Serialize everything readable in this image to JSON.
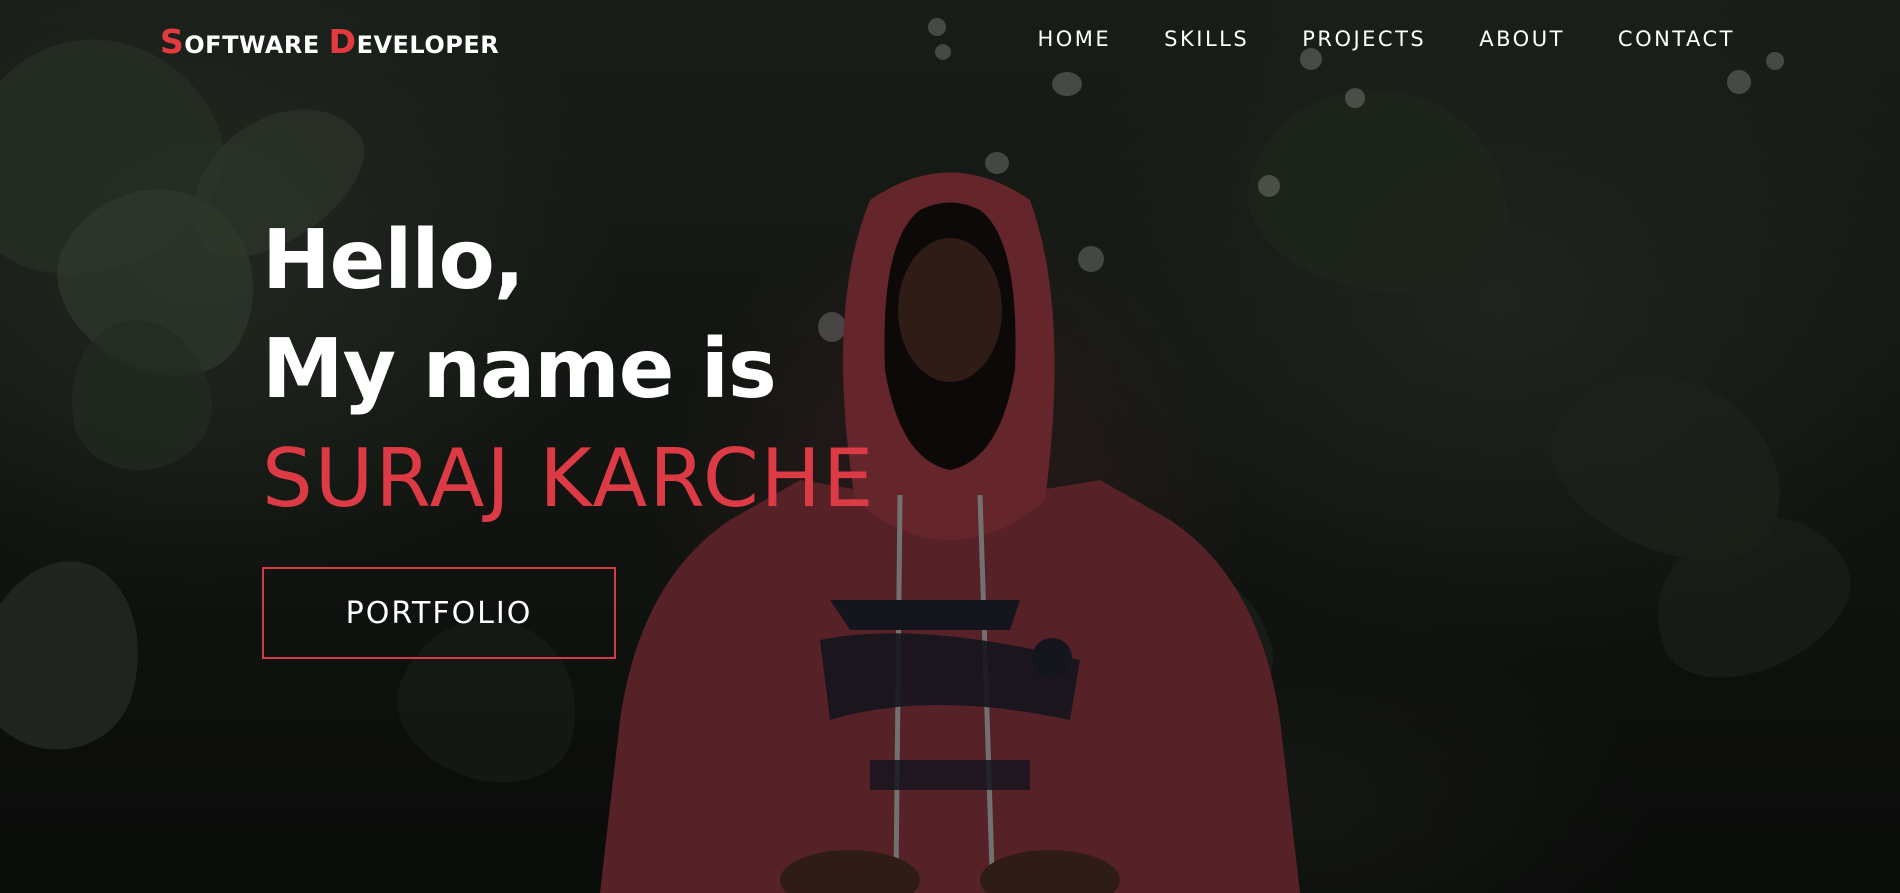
{
  "brand": {
    "first_cap": "S",
    "first_rest": "OFTWARE",
    "second_cap": "D",
    "second_rest": "EVELOPER"
  },
  "nav": {
    "items": [
      {
        "label": "HOME"
      },
      {
        "label": "SKILLS"
      },
      {
        "label": "PROJECTS"
      },
      {
        "label": "ABOUT"
      },
      {
        "label": "CONTACT"
      }
    ]
  },
  "hero": {
    "line1": "Hello,",
    "line2": "My name is",
    "name": "SURAJ KARCHE",
    "button_label": "PORTFOLIO"
  },
  "colors": {
    "accent": "#dc3a44",
    "text": "#ffffff",
    "background": "#151914"
  }
}
